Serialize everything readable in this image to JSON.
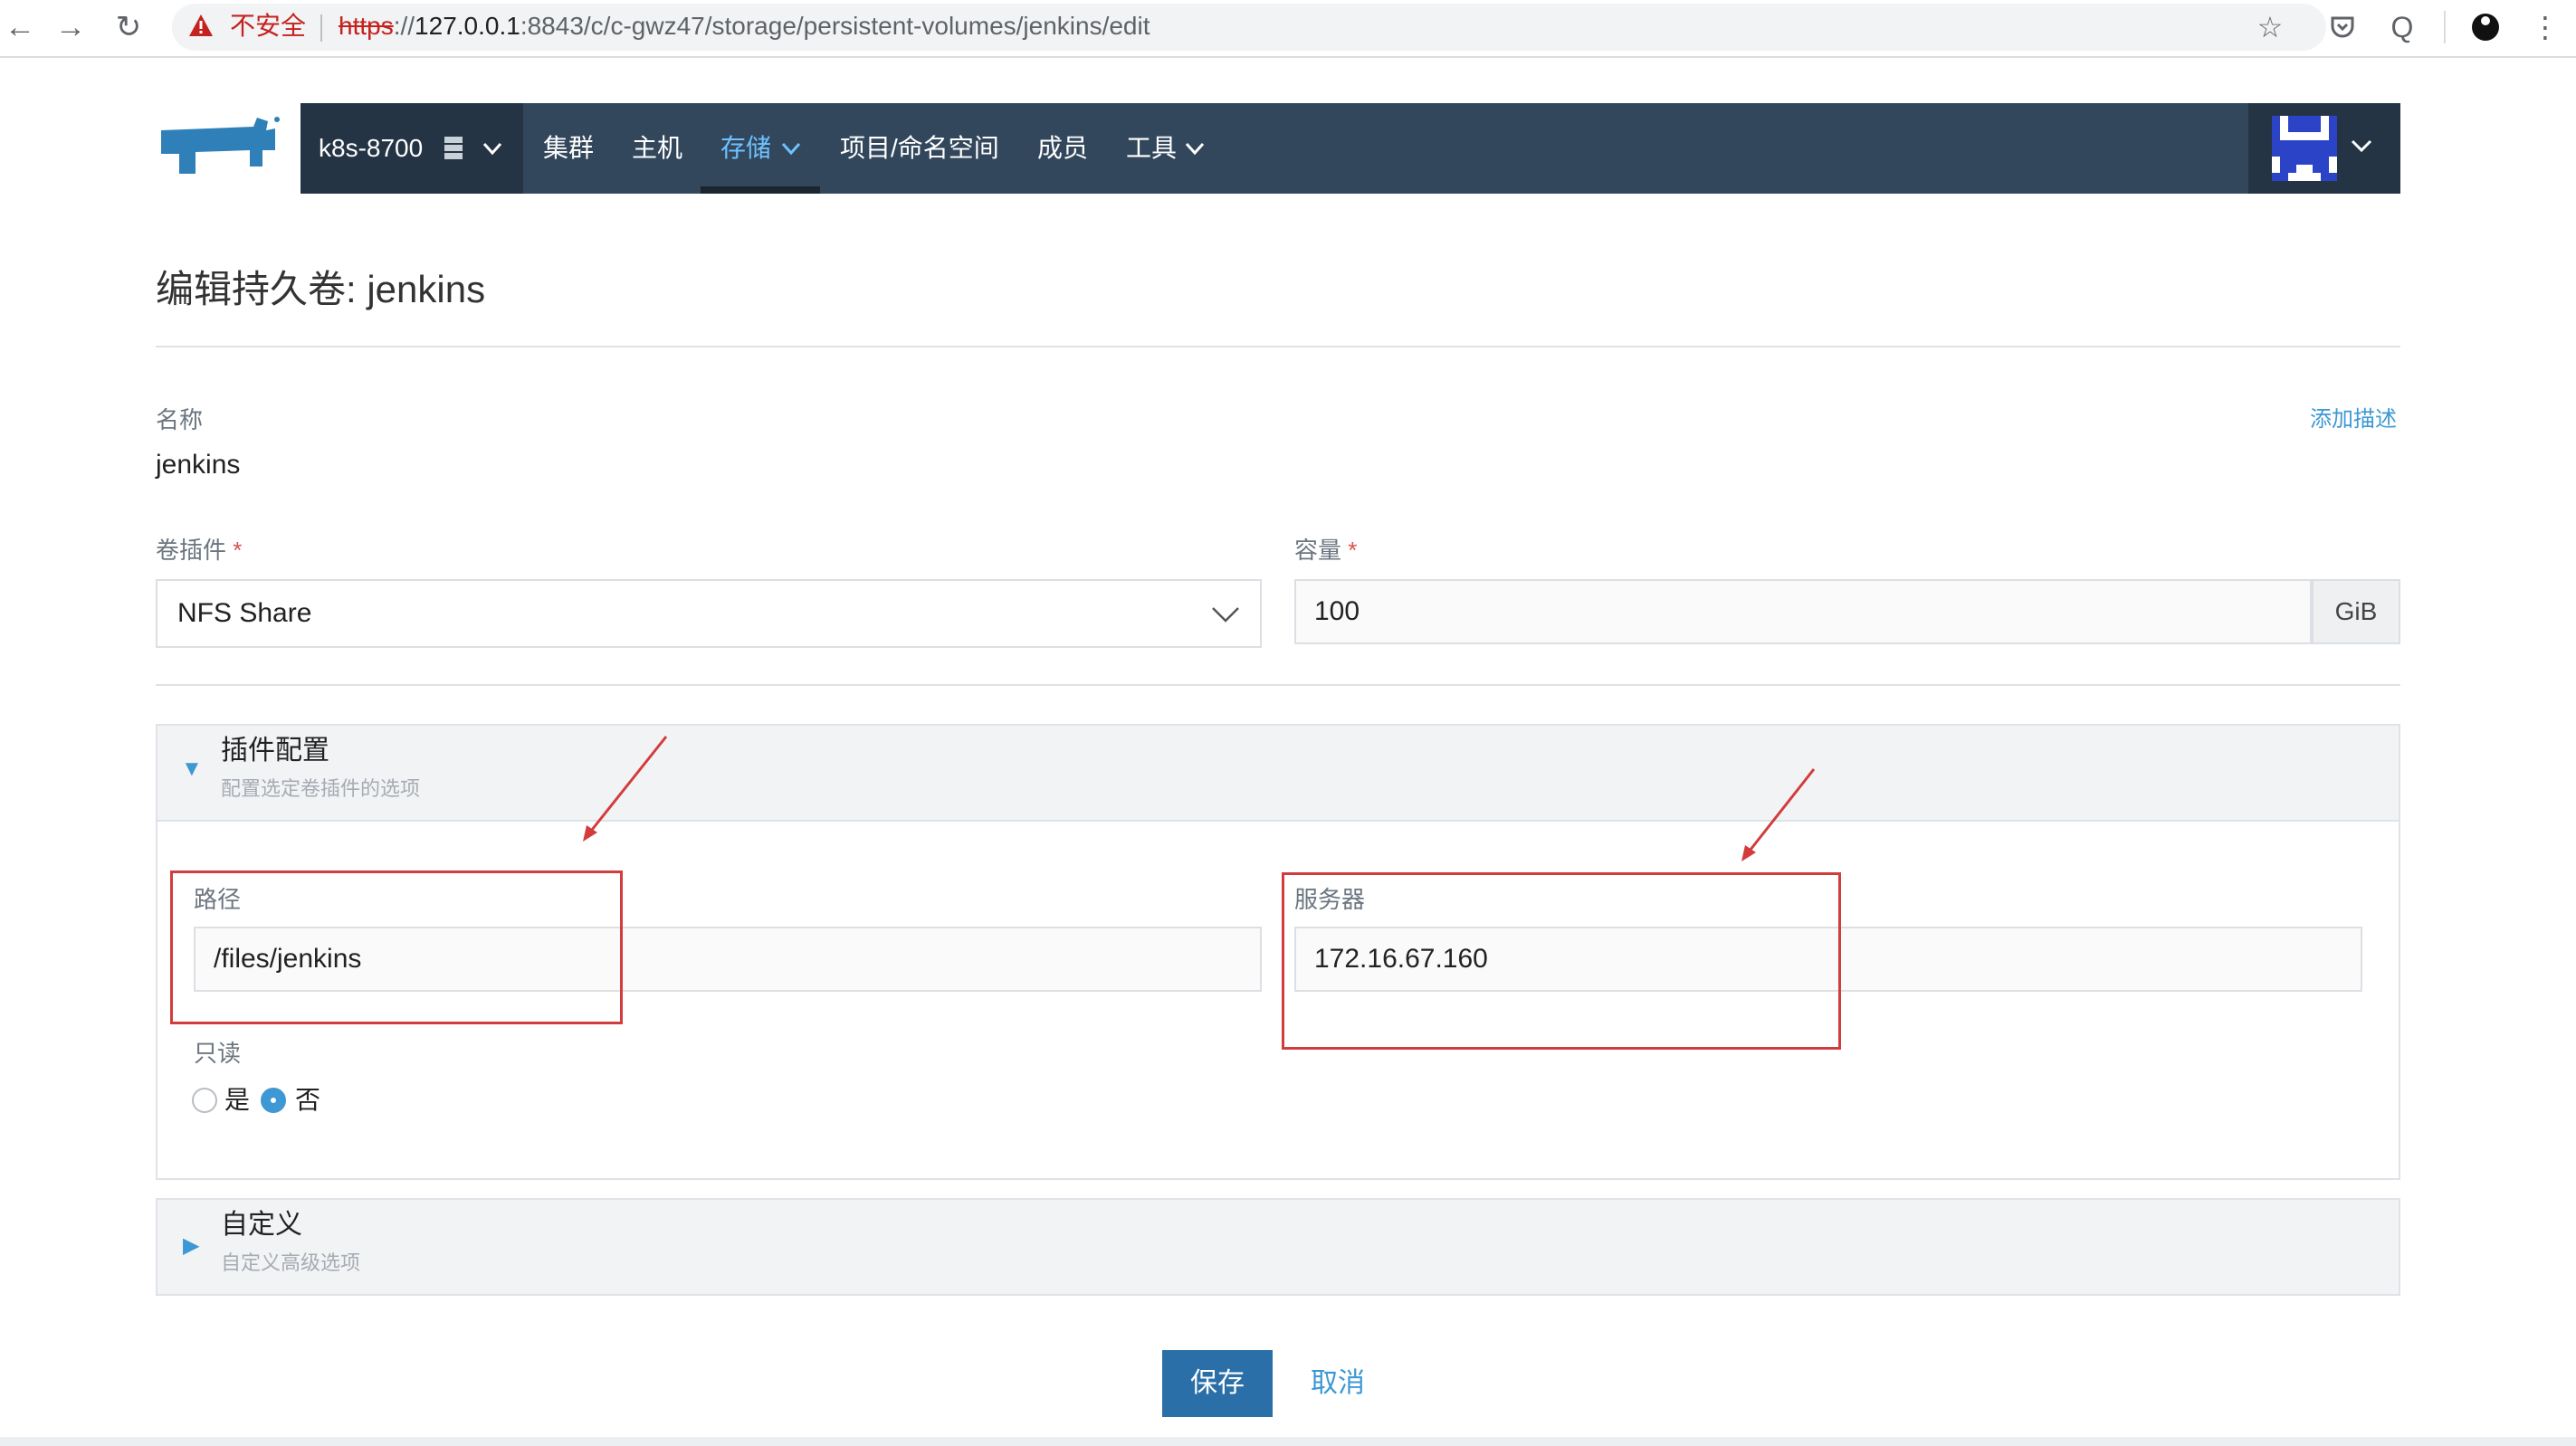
{
  "browser": {
    "security_label": "不安全",
    "url_scheme": "https",
    "url_host": "127.0.0.1",
    "url_rest": ":8843/c/c-gwz47/storage/persistent-volumes/jenkins/edit"
  },
  "header": {
    "cluster_name": "k8s-8700",
    "menu": {
      "cluster": "集群",
      "hosts": "主机",
      "storage": "存储",
      "projects": "项目/命名空间",
      "members": "成员",
      "tools": "工具"
    }
  },
  "page": {
    "title": "编辑持久卷: jenkins",
    "name_label": "名称",
    "name_value": "jenkins",
    "add_description": "添加描述",
    "plugin_label": "卷插件",
    "plugin_value": "NFS Share",
    "capacity_label": "容量",
    "capacity_value": "100",
    "capacity_unit": "GiB",
    "required_mark": "*"
  },
  "plugin_config": {
    "title": "插件配置",
    "subtitle": "配置选定卷插件的选项",
    "path_label": "路径",
    "path_value": "/files/jenkins",
    "server_label": "服务器",
    "server_value": "172.16.67.160",
    "readonly_label": "只读",
    "readonly_yes": "是",
    "readonly_no": "否",
    "readonly_selected": "否"
  },
  "customize": {
    "title": "自定义",
    "subtitle": "自定义高级选项"
  },
  "actions": {
    "save": "保存",
    "cancel": "取消"
  },
  "colors": {
    "header_bg": "#33475c",
    "accent": "#3d98d3",
    "primary_button": "#2a6fa8",
    "annotation_red": "#d33c3c"
  }
}
